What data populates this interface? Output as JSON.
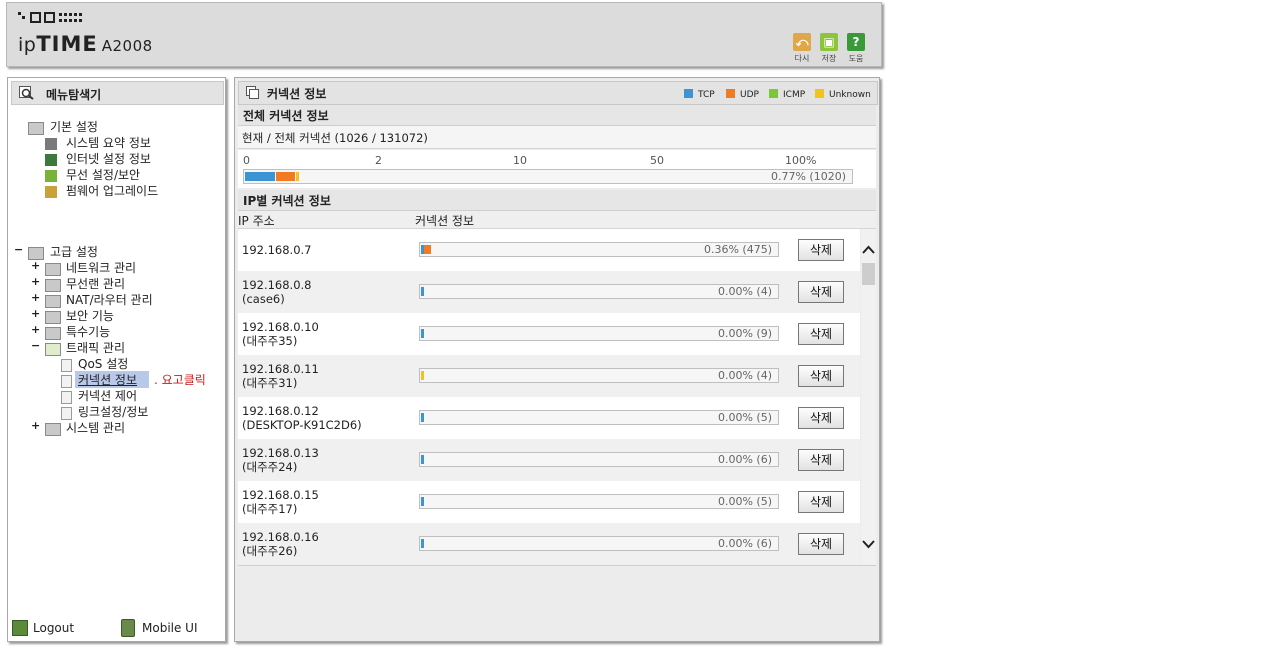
{
  "header": {
    "brand_prefix": "ip",
    "brand_time": "TIME",
    "model": "A2008",
    "toolbar": [
      {
        "label": "다시",
        "icon": "undo-icon",
        "color": "#e0a64a"
      },
      {
        "label": "저장",
        "icon": "save-icon",
        "color": "#8ec43c"
      },
      {
        "label": "도움",
        "icon": "help-icon",
        "color": "#3a9a3a"
      }
    ]
  },
  "sidebar": {
    "title": "메뉴탐색기",
    "basic": {
      "label": "기본 설정",
      "items": [
        "시스템 요약 정보",
        "인터넷 설정 정보",
        "무선 설정/보안",
        "펌웨어 업그레이드"
      ]
    },
    "advanced": {
      "label": "고급 설정",
      "items": [
        {
          "label": "네트워크 관리",
          "expander": "+"
        },
        {
          "label": "무선랜 관리",
          "expander": "+"
        },
        {
          "label": "NAT/라우터 관리",
          "expander": "+"
        },
        {
          "label": "보안 기능",
          "expander": "+"
        },
        {
          "label": "특수기능",
          "expander": "+"
        },
        {
          "label": "트래픽 관리",
          "expander": "−"
        }
      ],
      "traffic_sub": [
        "QoS 설정",
        "커넥션 정보",
        "커넥션 제어",
        "링크설정/정보"
      ],
      "last": {
        "label": "시스템 관리",
        "expander": "+"
      }
    },
    "annotation": ". 요고클릭",
    "footer": {
      "logout": "Logout",
      "mobile": "Mobile UI"
    }
  },
  "main": {
    "title": "커넥션 정보",
    "legend": [
      {
        "name": "TCP",
        "color": "#3b95d4"
      },
      {
        "name": "UDP",
        "color": "#f27a20"
      },
      {
        "name": "ICMP",
        "color": "#7dc63c"
      },
      {
        "name": "Unknown",
        "color": "#f2c21e"
      }
    ],
    "section_total": "전체 커넥션 정보",
    "total_text": "현재 / 전체 커넥션 (1026 / 131072)",
    "scale_ticks": [
      "0",
      "2",
      "10",
      "50",
      "100%"
    ],
    "total_bar": {
      "text": "0.77% (1020)",
      "tcp": 0.05,
      "udp": 0.031,
      "icmp": 0.0,
      "unknown": 0.005
    },
    "section_ip": "IP별 커넥션 정보",
    "col_ip": "IP 주소",
    "col_conn": "커넥션 정보",
    "delete_label": "삭제",
    "rows": [
      {
        "ip": "192.168.0.7",
        "name": "",
        "text": "0.36% (475)",
        "tcp": 0.008,
        "udp": 0.02,
        "unknown": 0.0
      },
      {
        "ip": "192.168.0.8",
        "name": "(case6)",
        "text": "0.00% (4)",
        "tcp": 0.008,
        "udp": 0.0,
        "unknown": 0.0
      },
      {
        "ip": "192.168.0.10",
        "name": "(대주주35)",
        "text": "0.00% (9)",
        "tcp": 0.004,
        "udp": 0.0,
        "unknown": 0.0
      },
      {
        "ip": "192.168.0.11",
        "name": "(대주주31)",
        "text": "0.00% (4)",
        "tcp": 0.0,
        "udp": 0.0,
        "unknown": 0.005
      },
      {
        "ip": "192.168.0.12",
        "name": "(DESKTOP-K91C2D6)",
        "text": "0.00% (5)",
        "tcp": 0.006,
        "udp": 0.0,
        "unknown": 0.0
      },
      {
        "ip": "192.168.0.13",
        "name": "(대주주24)",
        "text": "0.00% (6)",
        "tcp": 0.006,
        "udp": 0.0,
        "unknown": 0.0
      },
      {
        "ip": "192.168.0.15",
        "name": "(대주주17)",
        "text": "0.00% (5)",
        "tcp": 0.006,
        "udp": 0.0,
        "unknown": 0.0
      },
      {
        "ip": "192.168.0.16",
        "name": "(대주주26)",
        "text": "0.00% (6)",
        "tcp": 0.006,
        "udp": 0.0,
        "unknown": 0.0
      }
    ]
  }
}
